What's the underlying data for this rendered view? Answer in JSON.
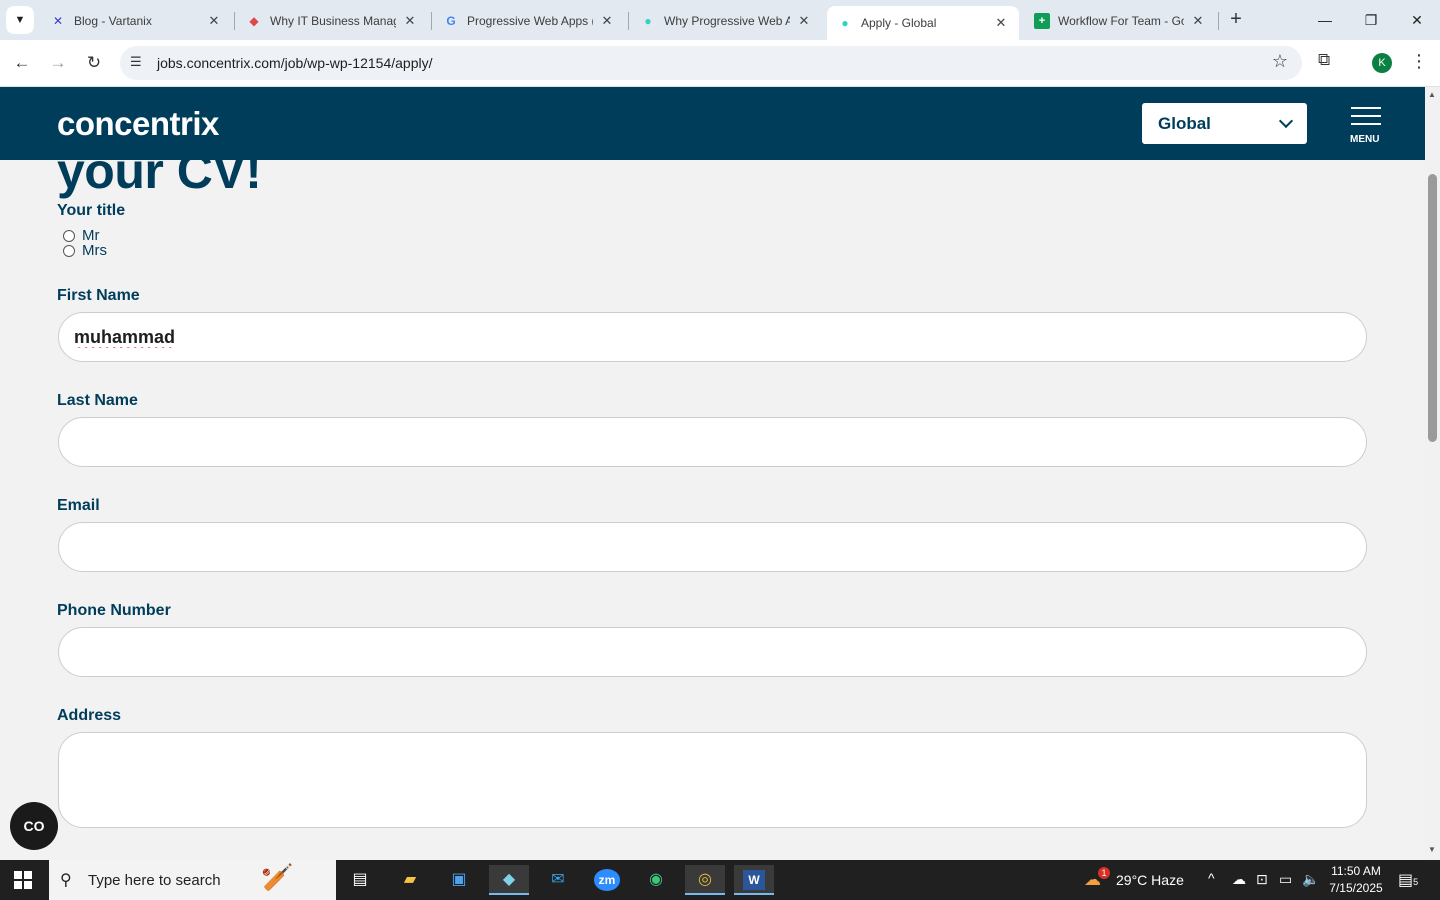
{
  "browser": {
    "tabs": [
      {
        "title": "Blog - Vartanix",
        "icon": "vartanix-x-icon",
        "color": "#3b3bd6"
      },
      {
        "title": "Why IT Business Manag",
        "icon": "diamond-icon",
        "color": "#e04848"
      },
      {
        "title": "Progressive Web Apps (",
        "icon": "google-g-icon",
        "color": "#4285f4"
      },
      {
        "title": "Why Progressive Web A",
        "icon": "concentrix-dot-icon",
        "color": "#003d5b"
      },
      {
        "title": "Apply - Global",
        "icon": "concentrix-dot-icon",
        "color": "#003d5b",
        "active": true
      },
      {
        "title": "Workflow For Team - Go",
        "icon": "sheets-icon",
        "color": "#0f9d58"
      }
    ],
    "url": "jobs.concentrix.com/job/wp-wp-12154/apply/",
    "profile_initial": "K"
  },
  "site": {
    "logo": "concentrix",
    "region": "Global",
    "menu_label": "MENU",
    "brand_color": "#003d5b"
  },
  "form": {
    "heading_fragment": "your CV!",
    "title_label": "Your title",
    "title_options": [
      "Mr",
      "Mrs"
    ],
    "first_name_label": "First Name",
    "first_name_value": "muhammad",
    "last_name_label": "Last Name",
    "email_label": "Email",
    "phone_label": "Phone Number",
    "address_label": "Address"
  },
  "taskbar": {
    "search_placeholder": "Type here to search",
    "weather": "29°C  Haze",
    "weather_badge": "1",
    "time": "11:50 AM",
    "date": "7/15/2025",
    "notification_count": "5"
  }
}
